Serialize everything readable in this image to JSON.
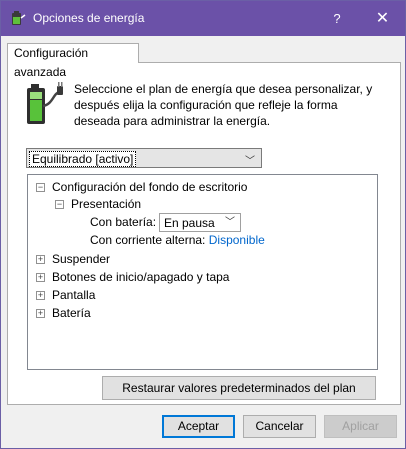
{
  "window": {
    "title": "Opciones de energía",
    "help_label": "?",
    "close_label": "✕"
  },
  "tab": {
    "label": "Configuración avanzada"
  },
  "description": "Seleccione el plan de energía que desea personalizar, y después elija la configuración que refleje la forma deseada para administrar la energía.",
  "plan_select": {
    "value": "Equilibrado [activo]"
  },
  "tree": {
    "desktop_bg": "Configuración del fondo de escritorio",
    "slideshow": "Presentación",
    "battery_label": "Con batería:",
    "battery_value": "En pausa",
    "ac_label": "Con corriente alterna:",
    "ac_value": "Disponible",
    "items": [
      "Suspender",
      "Botones de inicio/apagado y tapa",
      "Pantalla",
      "Batería"
    ]
  },
  "restore_label": "Restaurar valores predeterminados del plan",
  "buttons": {
    "ok": "Aceptar",
    "cancel": "Cancelar",
    "apply": "Aplicar"
  },
  "icons": {
    "app": "power-options-icon",
    "battery": "battery-plug-icon"
  },
  "colors": {
    "titlebar": "#6b51a8",
    "link": "#0066cc",
    "focus": "#0078d7"
  }
}
